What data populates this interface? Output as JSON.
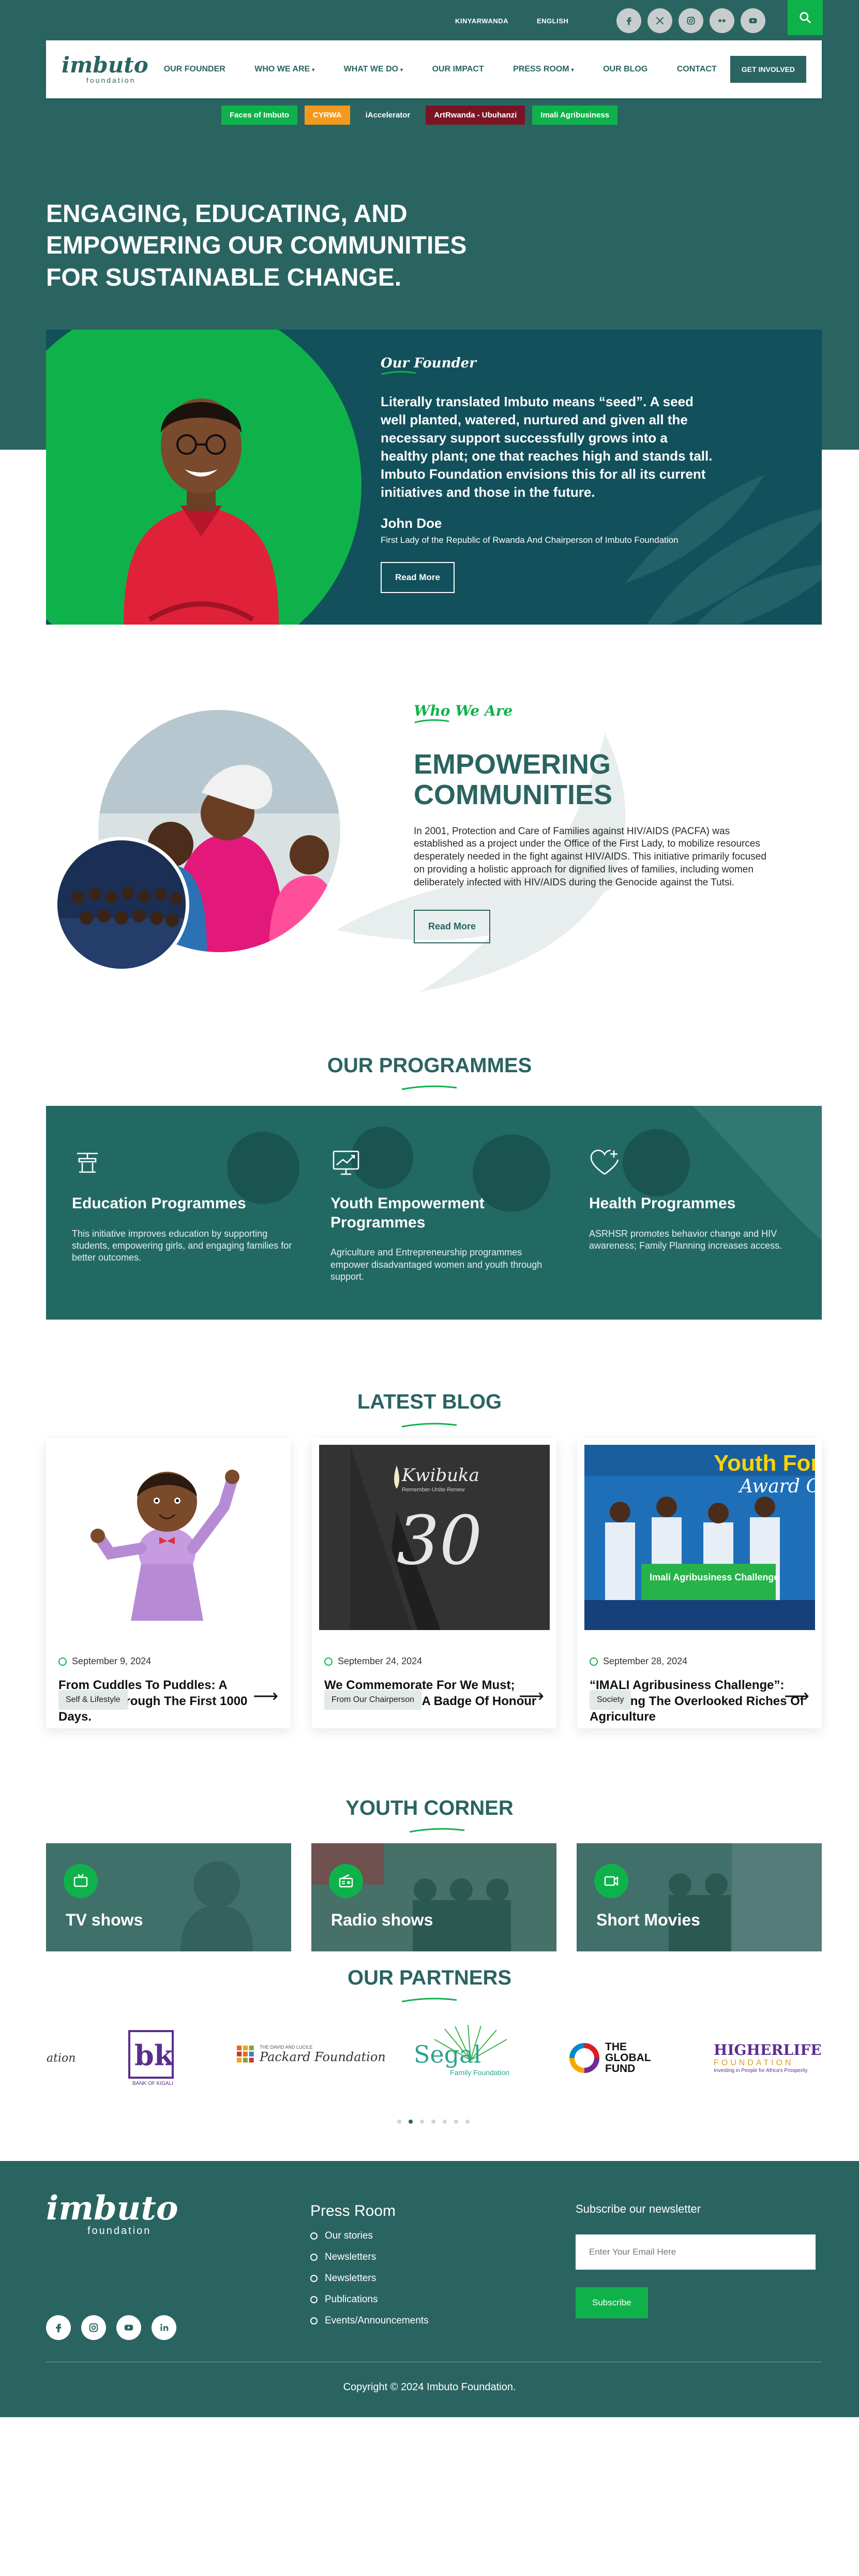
{
  "topbar": {
    "lang_rw": "KINYARWANDA",
    "lang_en": "ENGLISH"
  },
  "brand": {
    "logo_word": "imbuto",
    "logo_sub": "foundation"
  },
  "nav": {
    "items": [
      "OUR FOUNDER",
      "WHO WE ARE",
      "WHAT WE DO",
      "OUR IMPACT",
      "PRESS ROOM",
      "OUR BLOG",
      "CONTACT"
    ],
    "dropdown_caret": "▾",
    "cta": "GET INVOLVED"
  },
  "tags": [
    {
      "label": "Faces of Imbuto",
      "color": "#0fb24a"
    },
    {
      "label": "CYRWA",
      "color": "#f39a1e"
    },
    {
      "label": "iAccelerator",
      "color": "#2a6461"
    },
    {
      "label": "ArtRwanda - Ubuhanzi",
      "color": "#7a1424"
    },
    {
      "label": "Imali Agribusiness",
      "color": "#0fb24a"
    }
  ],
  "hero": {
    "title": "ENGAGING, EDUCATING, AND EMPOWERING OUR COMMUNITIES FOR SUSTAINABLE CHANGE."
  },
  "founder": {
    "eyebrow": "Our Founder",
    "quote": "Literally translated Imbuto means “seed”. A seed well planted, watered, nurtured and given all the necessary support successfully grows into a healthy plant; one that reaches high and stands tall. Imbuto Foundation envisions this for all its current initiatives and those in the future.",
    "name": "John Doe",
    "role": "First Lady of the Republic of Rwanda And Chairperson of Imbuto Foundation",
    "button": "Read More"
  },
  "who": {
    "eyebrow": "Who We Are",
    "title": "EMPOWERING COMMUNITIES",
    "body": "In 2001, Protection and Care of Families against HIV/AIDS (PACFA) was established as a project under the Office of the First Lady, to mobilize resources desperately needed in the fight against HIV/AIDS. This initiative primarily focused on providing a holistic approach for dignified lives of families, including women deliberately infected with HIV/AIDS during the Genocide against the Tutsi.",
    "button": "Read More"
  },
  "programmes": {
    "title": "OUR PROGRAMMES",
    "items": [
      {
        "title": "Education Programmes",
        "text": "This initiative improves education by supporting students, empowering girls, and engaging families for better outcomes.",
        "icon": "education-icon"
      },
      {
        "title": "Youth Empowerment Programmes",
        "text": "Agriculture and Entrepreneurship programmes empower disadvantaged women and youth through support.",
        "icon": "growth-chart-icon"
      },
      {
        "title": "Health Programmes",
        "text": "ASRHSR promotes behavior change and HIV awareness; Family Planning increases access.",
        "icon": "heart-plus-icon"
      }
    ]
  },
  "blog": {
    "title": "LATEST BLOG",
    "posts": [
      {
        "date": "September 9, 2024",
        "title": "From Cuddles To Puddles: A Journey Through The First 1000 Days.",
        "tag": "Self & Lifestyle"
      },
      {
        "date": "September 24, 2024",
        "title": "We Commemorate For We Must; Genocide Is Not A Badge Of Honour",
        "tag": "From Our Chairperson",
        "thumb_text": {
          "kwibuka": "Kwibuka",
          "sub": "Remember-Unite-Renew",
          "num": "30"
        }
      },
      {
        "date": "September 28, 2024",
        "title": "“IMALI Agribusiness Challenge”: Unveiling The Overlooked Riches Of Agriculture",
        "tag": "Society",
        "thumb_text": {
          "banner1": "Youth For",
          "banner2": "Award Ce",
          "board": "Imali Agribusiness Challenge"
        }
      }
    ],
    "arrow": "⟶"
  },
  "youth": {
    "title": "YOUTH CORNER",
    "items": [
      {
        "label": "TV shows",
        "icon": "tv-icon"
      },
      {
        "label": "Radio shows",
        "icon": "radio-icon"
      },
      {
        "label": "Short Movies",
        "icon": "movie-icon"
      }
    ]
  },
  "partners": {
    "title": "OUR PARTNERS",
    "logos": {
      "p0": "ation",
      "bk": "bk",
      "bk_sub": "BANK OF KIGALI",
      "packard_top": "THE DAVID AND LUCILE",
      "packard": "Packard Foundation",
      "segal": "Segal",
      "segal_sub": "Family Foundation",
      "global1": "THE",
      "global2": "GLOBAL",
      "global3": "FUND",
      "hl": "HIGHERLIFE",
      "hl_sub": "FOUNDATION",
      "hl_tag": "Investing in People for Africa's Prosperity"
    },
    "pager_count": 7,
    "pager_active": 1
  },
  "footer": {
    "press_title": "Press Room",
    "press_links": [
      "Our stories",
      "Newsletters",
      "Newsletters",
      "Publications",
      "Events/Announcements"
    ],
    "subscribe_title": "Subscribe our newsletter",
    "email_placeholder": "Enter Your Email Here",
    "subscribe_button": "Subscribe",
    "copyright": "Copyright © 2024 Imbuto Foundation."
  },
  "colors": {
    "primary": "#2a6461",
    "accent": "#0fb24a",
    "founder_card": "#12505b"
  }
}
